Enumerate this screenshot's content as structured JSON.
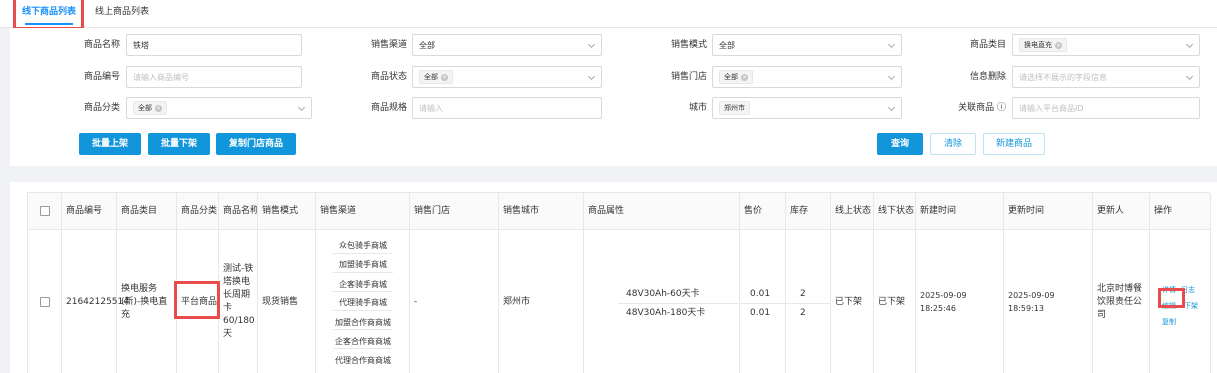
{
  "tabs": [
    "线下商品列表",
    "线上商品列表"
  ],
  "filters": {
    "name": {
      "label": "商品名称",
      "value": "铁塔"
    },
    "channel": {
      "label": "销售渠道",
      "value": "全部"
    },
    "mode": {
      "label": "销售模式",
      "value": "全部"
    },
    "category": {
      "label": "商品类目",
      "tag": "换电直充"
    },
    "code": {
      "label": "商品编号",
      "placeholder": "请输入商品编号"
    },
    "status": {
      "label": "商品状态",
      "tag": "全部"
    },
    "store": {
      "label": "销售门店",
      "tag": "全部"
    },
    "info_delete": {
      "label": "信息删除",
      "placeholder": "请选择不展示的字段信息"
    },
    "classify": {
      "label": "商品分类",
      "tag": "全部"
    },
    "spec": {
      "label": "商品规格",
      "placeholder": "请输入"
    },
    "city": {
      "label": "城市",
      "tag": "郑州市"
    },
    "related": {
      "label": "关联商品 ⓘ",
      "placeholder": "请输入平台商品ID"
    }
  },
  "buttons": {
    "batch_on": "批量上架",
    "batch_off": "批量下架",
    "copy_store": "复制门店商品",
    "query": "查询",
    "clear": "清除",
    "new": "新建商品"
  },
  "table": {
    "headers": [
      "商品编号",
      "商品类目",
      "商品分类",
      "商品名称",
      "销售模式",
      "销售渠道",
      "销售门店",
      "销售城市",
      "商品属性",
      "售价",
      "库存",
      "线上状态",
      "线下状态",
      "新建时间",
      "更新时间",
      "更新人",
      "操作"
    ],
    "row": {
      "code": "21642125514",
      "category": "换电服务(新)-换电直充",
      "classify": "平台商品",
      "name": "测试-铁塔换电长周期卡60/180天",
      "mode": "现货销售",
      "channels": [
        "众包骑手商城",
        "加盟骑手商城",
        "企客骑手商城",
        "代理骑手商城",
        "加盟合作商商城",
        "企客合作商商城",
        "代理合作商商城"
      ],
      "store": "-",
      "city": "郑州市",
      "attrs": [
        "48V30Ah-60天卡",
        "48V30Ah-180天卡"
      ],
      "prices": [
        "0.01",
        "0.01"
      ],
      "stocks": [
        "2",
        "2"
      ],
      "online_status": "已下架",
      "offline_status": "已下架",
      "created": "2025-09-09 18:25:46",
      "updated": "2025-09-09 18:59:13",
      "updater": "北京时博餐饮限责任公司",
      "ops": {
        "detail": "详情",
        "log": "日志",
        "edit": "编辑",
        "off": "下架",
        "copy": "复制"
      }
    }
  },
  "colors": {
    "primary": "#1296db",
    "highlight": "#e84c4c"
  }
}
